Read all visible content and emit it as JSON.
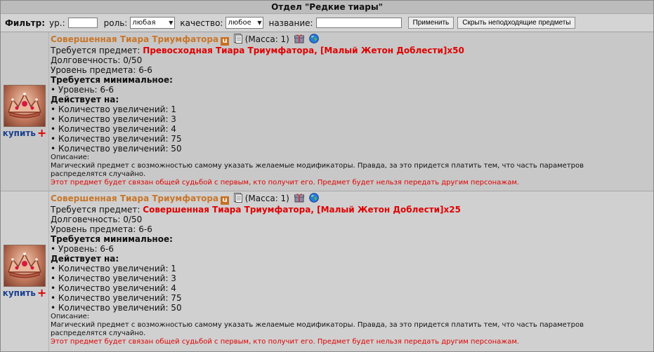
{
  "section_title": "Отдел \"Редкие тиары\"",
  "filter": {
    "label": "Фильтр:",
    "level_label": "ур.:",
    "level_value": "",
    "role_label": "роль:",
    "role_selected": "любая",
    "quality_label": "качество:",
    "quality_selected": "любое",
    "name_label": "название:",
    "name_value": "",
    "apply_label": "Применить",
    "hide_label": "Скрыть неподходящие предметы"
  },
  "items": [
    {
      "name": "Совершенная Тиара Триумфатора",
      "badge": "u",
      "mass": "(Масса: 1)",
      "buy_label": "купить",
      "required_item_label": "Требуется предмет:",
      "required_item_value": "Превосходная Тиара Триумфатора, [Малый Жетон Доблести]x50",
      "durability": "Долговечность: 0/50",
      "item_level": "Уровень предмета: 6-6",
      "min_required_label": "Требуется минимальное:",
      "min_level": "• Уровень: 6-6",
      "acts_on_label": "Действует на:",
      "effects": [
        "• Количество увеличений: 1",
        "• Количество увеличений: 3",
        "• Количество увеличений: 4",
        "• Количество увеличений: 75",
        "• Количество увеличений: 50"
      ],
      "description_label": "Описание:",
      "description": "Магический предмет с возможностью самому указать желаемые модификаторы. Правда, за это придется платить тем, что часть параметров распределятся случайно.",
      "binding_note": "Этот предмет будет связан общей судьбой с первым, кто получит его. Предмет будет нельзя передать другим персонажам."
    },
    {
      "name": "Совершенная Тиара Триумфатора",
      "badge": "u",
      "mass": "(Масса: 1)",
      "buy_label": "купить",
      "required_item_label": "Требуется предмет:",
      "required_item_value": "Совершенная Тиара Триумфатора, [Малый Жетон Доблести]x25",
      "durability": "Долговечность: 0/50",
      "item_level": "Уровень предмета: 6-6",
      "min_required_label": "Требуется минимальное:",
      "min_level": "• Уровень: 6-6",
      "acts_on_label": "Действует на:",
      "effects": [
        "• Количество увеличений: 1",
        "• Количество увеличений: 3",
        "• Количество увеличений: 4",
        "• Количество увеличений: 75",
        "• Количество увеличений: 50"
      ],
      "description_label": "Описание:",
      "description": "Магический предмет с возможностью самому указать желаемые модификаторы. Правда, за это придется платить тем, что часть параметров распределятся случайно.",
      "binding_note": "Этот предмет будет связан общей судьбой с первым, кто получит его. Предмет будет нельзя передать другим персонажам."
    }
  ],
  "icons": {
    "tiara": "tiara-image",
    "document": "document-icon",
    "gift": "gift-icon",
    "globe": "globe-icon",
    "plus": "plus-icon"
  }
}
